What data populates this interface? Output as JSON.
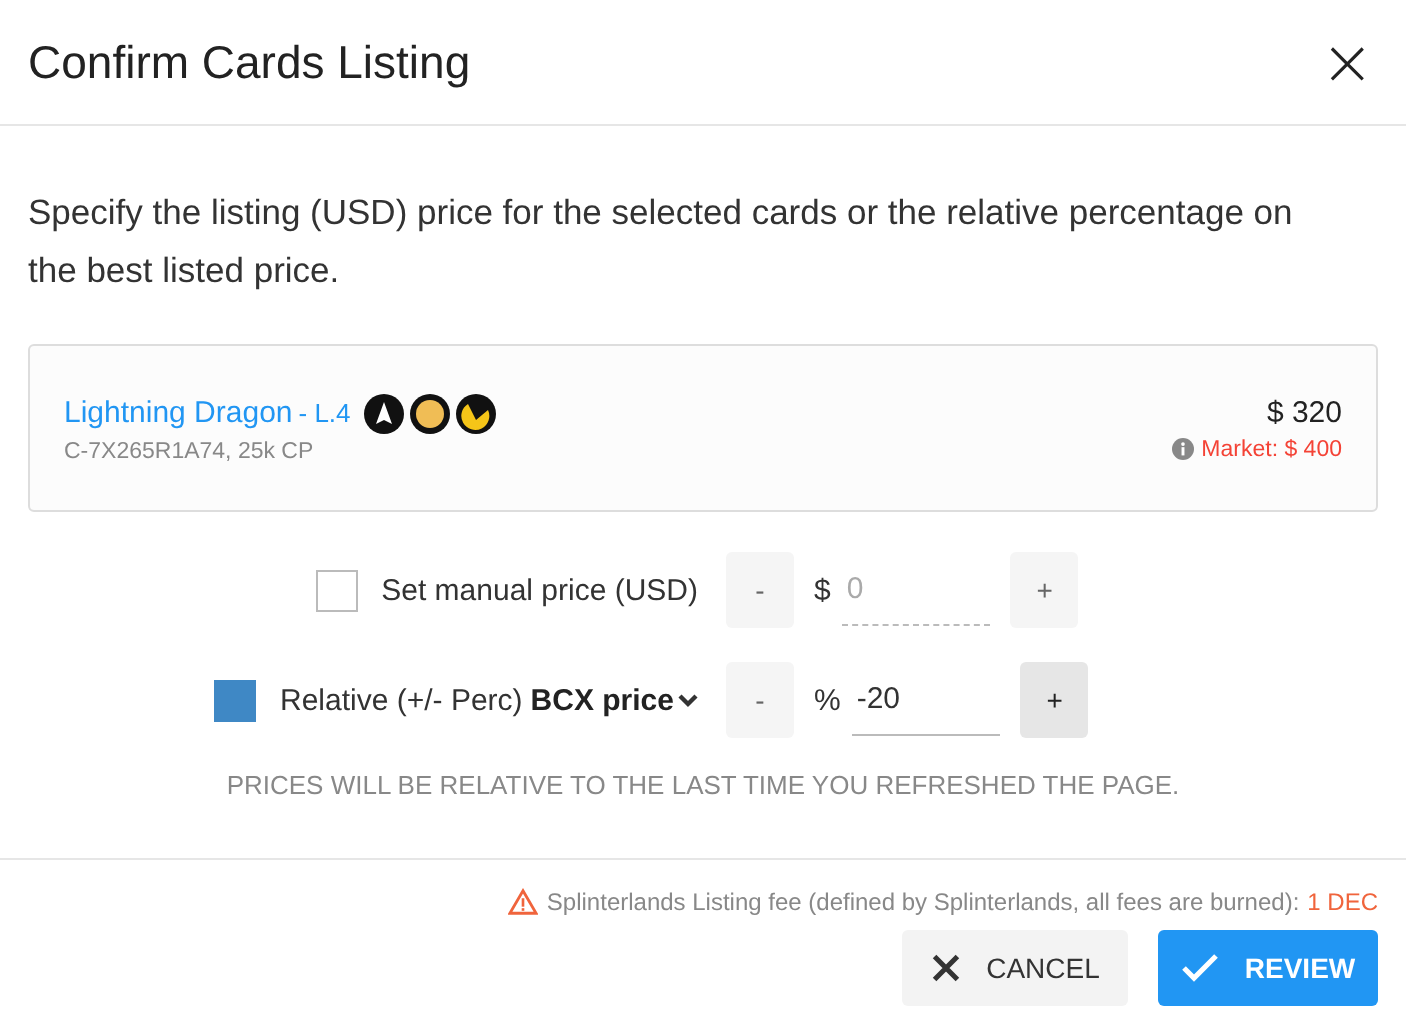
{
  "dialog": {
    "title": "Confirm Cards Listing",
    "close": "×"
  },
  "instructions": "Specify the listing (USD) price for the selected cards or the relative percentage on the best listed price.",
  "card": {
    "name": "Lightning Dragon",
    "level": "- L.4",
    "details": "C-7X265R1A74, 25k CP",
    "price": "$ 320",
    "market": "Market: $ 400"
  },
  "price_options": [
    {
      "kind": "manual",
      "label": "Set manual price (USD)",
      "checked": false,
      "minus": "-",
      "unit": "$",
      "value": "0",
      "plus": "+"
    },
    {
      "kind": "relative",
      "label": "Relative (+/- Perc)",
      "dropdown": "BCX price",
      "checked": true,
      "minus": "-",
      "unit": "%",
      "value": "-20",
      "plus": "+"
    }
  ],
  "note": "PRICES WILL BE RELATIVE TO THE LAST TIME YOU REFRESHED THE PAGE.",
  "fee": {
    "text": "Splinterlands Listing fee (defined by Splinterlands, all fees are burned):",
    "amount": "1 DEC"
  },
  "buttons": [
    {
      "kind": "cancel",
      "label": "CANCEL"
    },
    {
      "kind": "review",
      "label": "REVIEW"
    }
  ]
}
